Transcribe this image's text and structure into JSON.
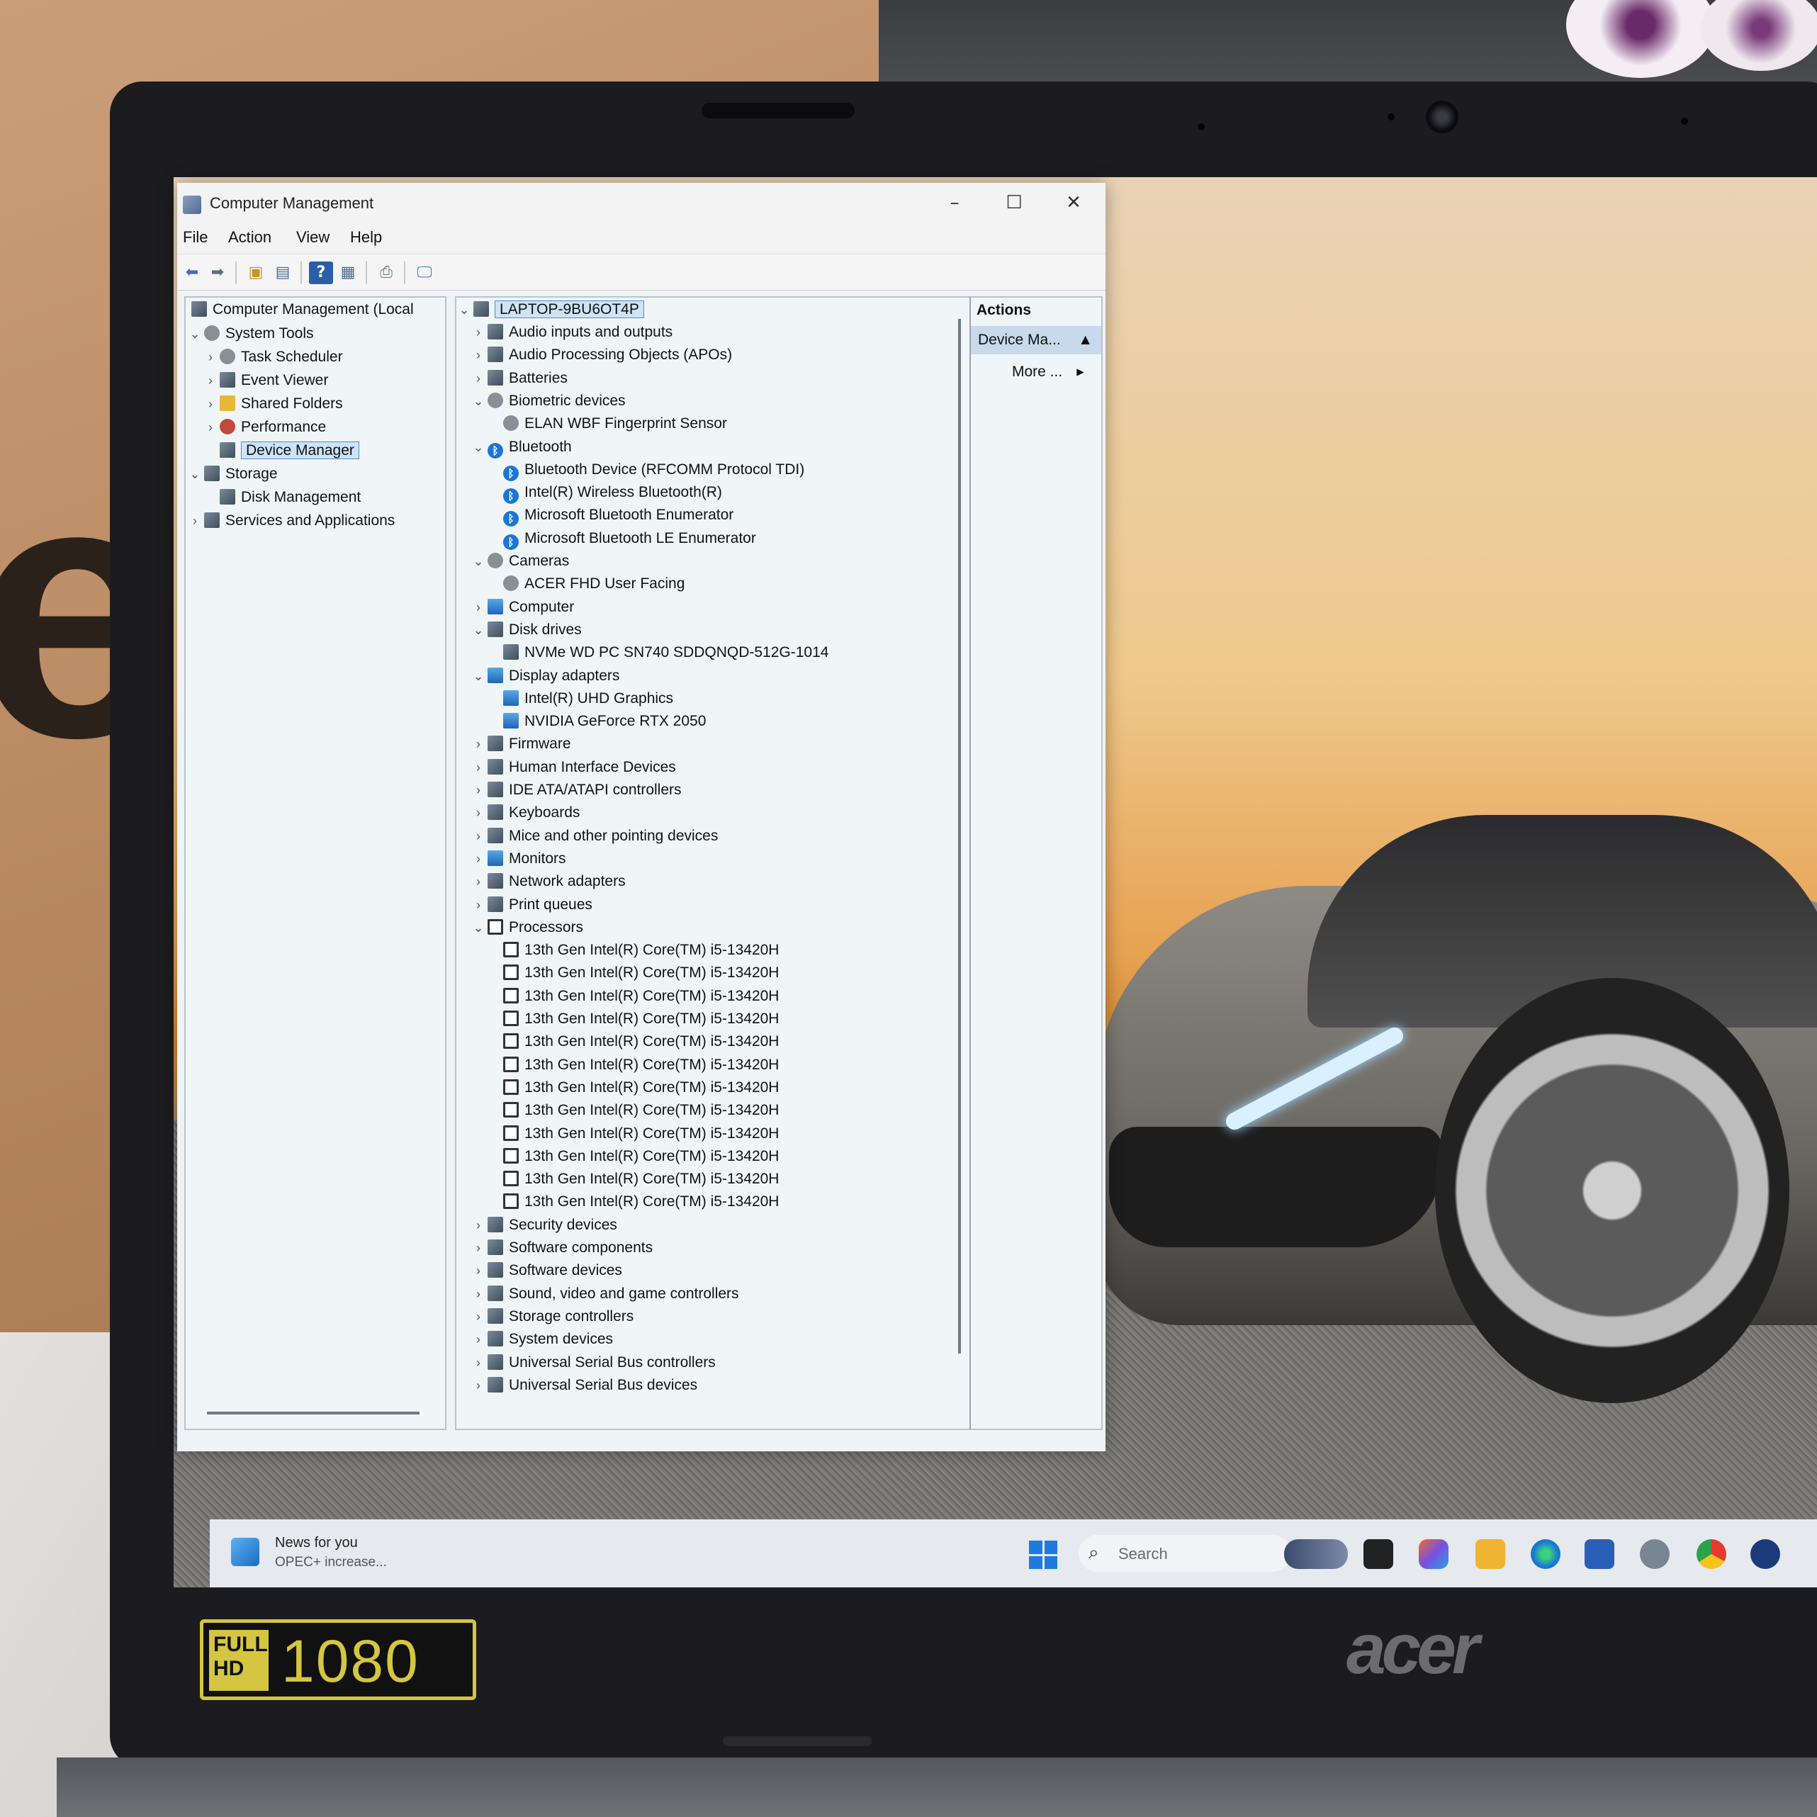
{
  "window": {
    "title": "Computer Management",
    "min": "–",
    "max": "☐",
    "close": "✕"
  },
  "menu": [
    "File",
    "Action",
    "View",
    "Help"
  ],
  "left_tree": [
    {
      "label": "Computer Management (Local",
      "level": 0,
      "chev": "",
      "icon": "computer-mgmt-icon"
    },
    {
      "label": "System Tools",
      "level": 1,
      "chev": "⌄",
      "icon": "tools-icon"
    },
    {
      "label": "Task Scheduler",
      "level": 2,
      "chev": "›",
      "icon": "clock-icon"
    },
    {
      "label": "Event Viewer",
      "level": 2,
      "chev": "›",
      "icon": "event-viewer-icon"
    },
    {
      "label": "Shared Folders",
      "level": 2,
      "chev": "›",
      "icon": "shared-folder-icon"
    },
    {
      "label": "Performance",
      "level": 2,
      "chev": "›",
      "icon": "performance-icon"
    },
    {
      "label": "Device Manager",
      "level": 2,
      "chev": "",
      "icon": "device-manager-icon",
      "selected": true
    },
    {
      "label": "Storage",
      "level": 1,
      "chev": "⌄",
      "icon": "storage-icon"
    },
    {
      "label": "Disk Management",
      "level": 2,
      "chev": "",
      "icon": "disk-icon"
    },
    {
      "label": "Services and Applications",
      "level": 1,
      "chev": "›",
      "icon": "services-icon"
    }
  ],
  "device_tree": {
    "root": "LAPTOP-9BU6OT4P",
    "items": [
      {
        "label": "Audio inputs and outputs",
        "level": 1,
        "chev": "›",
        "icon": "speaker-icon"
      },
      {
        "label": "Audio Processing Objects (APOs)",
        "level": 1,
        "chev": "›",
        "icon": "speaker-icon"
      },
      {
        "label": "Batteries",
        "level": 1,
        "chev": "›",
        "icon": "battery-icon"
      },
      {
        "label": "Biometric devices",
        "level": 1,
        "chev": "⌄",
        "icon": "fingerprint-icon"
      },
      {
        "label": "ELAN WBF Fingerprint Sensor",
        "level": 2,
        "chev": "",
        "icon": "fingerprint-icon"
      },
      {
        "label": "Bluetooth",
        "level": 1,
        "chev": "⌄",
        "icon": "bluetooth-icon"
      },
      {
        "label": "Bluetooth Device (RFCOMM Protocol TDI)",
        "level": 2,
        "chev": "",
        "icon": "bluetooth-icon"
      },
      {
        "label": "Intel(R) Wireless Bluetooth(R)",
        "level": 2,
        "chev": "",
        "icon": "bluetooth-icon"
      },
      {
        "label": "Microsoft Bluetooth Enumerator",
        "level": 2,
        "chev": "",
        "icon": "bluetooth-icon"
      },
      {
        "label": "Microsoft Bluetooth LE Enumerator",
        "level": 2,
        "chev": "",
        "icon": "bluetooth-icon"
      },
      {
        "label": "Cameras",
        "level": 1,
        "chev": "⌄",
        "icon": "camera-icon"
      },
      {
        "label": "ACER FHD User Facing",
        "level": 2,
        "chev": "",
        "icon": "camera-icon"
      },
      {
        "label": "Computer",
        "level": 1,
        "chev": "›",
        "icon": "monitor-icon"
      },
      {
        "label": "Disk drives",
        "level": 1,
        "chev": "⌄",
        "icon": "disk-icon"
      },
      {
        "label": "NVMe WD PC SN740 SDDQNQD-512G-1014",
        "level": 2,
        "chev": "",
        "icon": "disk-icon"
      },
      {
        "label": "Display adapters",
        "level": 1,
        "chev": "⌄",
        "icon": "monitor-icon"
      },
      {
        "label": "Intel(R) UHD Graphics",
        "level": 2,
        "chev": "",
        "icon": "monitor-icon"
      },
      {
        "label": "NVIDIA GeForce RTX 2050",
        "level": 2,
        "chev": "",
        "icon": "monitor-icon"
      },
      {
        "label": "Firmware",
        "level": 1,
        "chev": "›",
        "icon": "chip-icon"
      },
      {
        "label": "Human Interface Devices",
        "level": 1,
        "chev": "›",
        "icon": "hid-icon"
      },
      {
        "label": "IDE ATA/ATAPI controllers",
        "level": 1,
        "chev": "›",
        "icon": "controller-icon"
      },
      {
        "label": "Keyboards",
        "level": 1,
        "chev": "›",
        "icon": "keyboard-icon"
      },
      {
        "label": "Mice and other pointing devices",
        "level": 1,
        "chev": "›",
        "icon": "mouse-icon"
      },
      {
        "label": "Monitors",
        "level": 1,
        "chev": "›",
        "icon": "monitor-icon"
      },
      {
        "label": "Network adapters",
        "level": 1,
        "chev": "›",
        "icon": "network-icon"
      },
      {
        "label": "Print queues",
        "level": 1,
        "chev": "›",
        "icon": "printer-icon"
      },
      {
        "label": "Processors",
        "level": 1,
        "chev": "⌄",
        "icon": "processor-icon"
      },
      {
        "label": "13th Gen Intel(R) Core(TM) i5-13420H",
        "level": 2,
        "chev": "",
        "icon": "processor-icon"
      },
      {
        "label": "13th Gen Intel(R) Core(TM) i5-13420H",
        "level": 2,
        "chev": "",
        "icon": "processor-icon"
      },
      {
        "label": "13th Gen Intel(R) Core(TM) i5-13420H",
        "level": 2,
        "chev": "",
        "icon": "processor-icon"
      },
      {
        "label": "13th Gen Intel(R) Core(TM) i5-13420H",
        "level": 2,
        "chev": "",
        "icon": "processor-icon"
      },
      {
        "label": "13th Gen Intel(R) Core(TM) i5-13420H",
        "level": 2,
        "chev": "",
        "icon": "processor-icon"
      },
      {
        "label": "13th Gen Intel(R) Core(TM) i5-13420H",
        "level": 2,
        "chev": "",
        "icon": "processor-icon"
      },
      {
        "label": "13th Gen Intel(R) Core(TM) i5-13420H",
        "level": 2,
        "chev": "",
        "icon": "processor-icon"
      },
      {
        "label": "13th Gen Intel(R) Core(TM) i5-13420H",
        "level": 2,
        "chev": "",
        "icon": "processor-icon"
      },
      {
        "label": "13th Gen Intel(R) Core(TM) i5-13420H",
        "level": 2,
        "chev": "",
        "icon": "processor-icon"
      },
      {
        "label": "13th Gen Intel(R) Core(TM) i5-13420H",
        "level": 2,
        "chev": "",
        "icon": "processor-icon"
      },
      {
        "label": "13th Gen Intel(R) Core(TM) i5-13420H",
        "level": 2,
        "chev": "",
        "icon": "processor-icon"
      },
      {
        "label": "13th Gen Intel(R) Core(TM) i5-13420H",
        "level": 2,
        "chev": "",
        "icon": "processor-icon"
      },
      {
        "label": "Security devices",
        "level": 1,
        "chev": "›",
        "icon": "security-icon"
      },
      {
        "label": "Software components",
        "level": 1,
        "chev": "›",
        "icon": "software-icon"
      },
      {
        "label": "Software devices",
        "level": 1,
        "chev": "›",
        "icon": "software-icon"
      },
      {
        "label": "Sound, video and game controllers",
        "level": 1,
        "chev": "›",
        "icon": "speaker-icon"
      },
      {
        "label": "Storage controllers",
        "level": 1,
        "chev": "›",
        "icon": "storage-icon"
      },
      {
        "label": "System devices",
        "level": 1,
        "chev": "›",
        "icon": "system-icon"
      },
      {
        "label": "Universal Serial Bus controllers",
        "level": 1,
        "chev": "›",
        "icon": "usb-icon"
      },
      {
        "label": "Universal Serial Bus devices",
        "level": 1,
        "chev": "›",
        "icon": "usb-icon"
      }
    ]
  },
  "actions": {
    "header": "Actions",
    "selected": "Device Ma...",
    "more": "More ..."
  },
  "taskbar": {
    "news_title": "News for you",
    "news_sub": "OPEC+ increase...",
    "search": "Search"
  },
  "bezel": {
    "badge_top": "FULL",
    "badge_bottom": "HD",
    "resolution": "1080",
    "brand": "acer"
  }
}
